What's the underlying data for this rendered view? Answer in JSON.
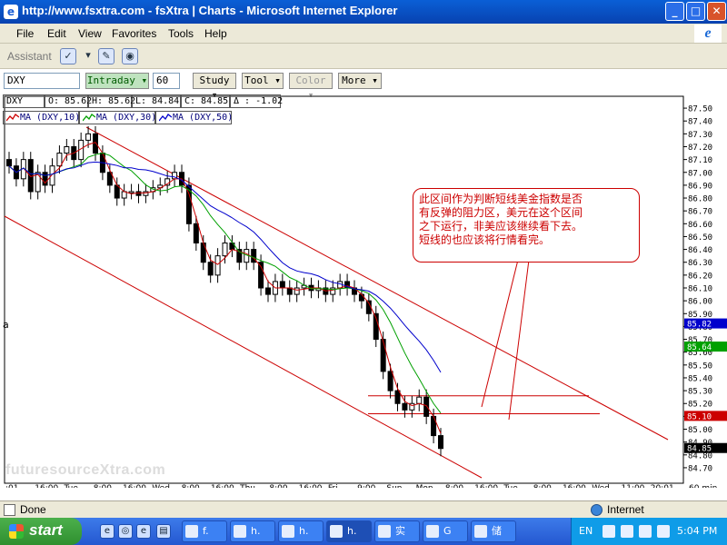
{
  "window": {
    "title": "http://www.fsxtra.com - fsXtra | Charts - Microsoft Internet Explorer",
    "icon": "ie-page-icon",
    "buttons": [
      "minimize",
      "maximize",
      "close"
    ]
  },
  "menu": {
    "items": [
      "File",
      "Edit",
      "View",
      "Favorites",
      "Tools",
      "Help"
    ]
  },
  "assistant": {
    "label": "Assistant"
  },
  "toolbar": {
    "symbol": "DXY",
    "interval_label": "Intraday",
    "interval_value": "60",
    "study_label": "Study",
    "tool_label": "Tool",
    "color_label": "Color",
    "more_label": "More"
  },
  "quote": {
    "symbol": "DXY",
    "open": "O: 85.62",
    "high": "H: 85.62",
    "low": "L: 84.84",
    "close": "C: 84.85",
    "change": "Δ : -1.02"
  },
  "indicators": [
    {
      "label": "MA (DXY,10)",
      "color": "#cc0000"
    },
    {
      "label": "MA (DXY,30)",
      "color": "#00a000"
    },
    {
      "label": "MA (DXY,50)",
      "color": "#0000cc"
    }
  ],
  "left_marker": "a",
  "watermark": "futuresourceXtra.com",
  "annotation": {
    "text_lines": [
      "此区间作为判断短线美金指数是否",
      "有反弹的阻力区，美元在这个区间",
      "之下运行，非美应该继续看下去。",
      "短线的也应该将行情看完。"
    ]
  },
  "chart_data": {
    "type": "candlestick",
    "title": "",
    "y_axis": {
      "ylim": [
        84.65,
        87.55
      ],
      "ticks": [
        "87.50",
        "87.40",
        "87.30",
        "87.20",
        "87.10",
        "87.00",
        "86.90",
        "86.80",
        "86.70",
        "86.60",
        "86.50",
        "86.40",
        "86.30",
        "86.20",
        "86.10",
        "86.00",
        "85.90",
        "85.80",
        "85.70",
        "85.60",
        "85.50",
        "85.40",
        "85.30",
        "85.20",
        "85.10",
        "85.00",
        "84.90",
        "84.80",
        "84.70"
      ],
      "tick_values": [
        87.5,
        87.4,
        87.3,
        87.2,
        87.1,
        87.0,
        86.9,
        86.8,
        86.7,
        86.6,
        86.5,
        86.4,
        86.3,
        86.2,
        86.1,
        86.0,
        85.9,
        85.8,
        85.7,
        85.6,
        85.5,
        85.4,
        85.3,
        85.2,
        85.1,
        85.0,
        84.9,
        84.8,
        84.7
      ],
      "badges": [
        {
          "label": "85.82",
          "value": 85.82,
          "color": "#0000cc"
        },
        {
          "label": "85.64",
          "value": 85.64,
          "color": "#00a000"
        },
        {
          "label": "85.10",
          "value": 85.1,
          "color": "#cc0000"
        },
        {
          "label": "84.85",
          "value": 84.85,
          "color": "#000000"
        }
      ]
    },
    "x_axis": {
      "labels": [
        ":01",
        "16:00",
        "Tue",
        "8:00",
        "16:00",
        "Wed",
        "8:00",
        "16:00",
        "Thu",
        "8:00",
        "16:00",
        "Fri",
        "9:00",
        "Sun",
        "Mon",
        "8:00",
        "16:00",
        "Tue",
        "8:00",
        "16:00",
        "Wed",
        "11:00",
        "20:01"
      ],
      "unit_label": "60 min."
    },
    "series": [
      {
        "name": "DXY",
        "type": "candlestick",
        "close": [
          87.05,
          86.95,
          87.1,
          86.85,
          87.0,
          86.9,
          87.05,
          87.15,
          87.2,
          87.1,
          87.25,
          87.3,
          87.15,
          87.0,
          86.9,
          86.8,
          86.85,
          86.85,
          86.82,
          86.85,
          86.88,
          86.9,
          86.95,
          87.0,
          86.9,
          86.6,
          86.45,
          86.3,
          86.2,
          86.35,
          86.45,
          86.4,
          86.3,
          86.4,
          86.3,
          86.1,
          86.05,
          86.15,
          86.1,
          86.05,
          86.1,
          86.12,
          86.08,
          86.1,
          86.05,
          86.1,
          86.15,
          86.1,
          86.05,
          86.0,
          85.9,
          85.7,
          85.45,
          85.3,
          85.2,
          85.15,
          85.2,
          85.25,
          85.1,
          84.95,
          84.85
        ]
      },
      {
        "name": "MA (DXY,10)",
        "color": "#cc0000"
      },
      {
        "name": "MA (DXY,30)",
        "color": "#00a000"
      },
      {
        "name": "MA (DXY,50)",
        "color": "#0000cc"
      }
    ],
    "annotations": {
      "resistance_zone": [
        85.12,
        85.26
      ],
      "channel": "descending"
    }
  },
  "statusbar": {
    "status": "Done",
    "zone": "Internet"
  },
  "taskbar": {
    "start_label": "start",
    "tasks": [
      {
        "label": "f."
      },
      {
        "label": "h."
      },
      {
        "label": "h."
      },
      {
        "label": "h."
      },
      {
        "label": "实"
      },
      {
        "label": "G"
      },
      {
        "label": "储"
      }
    ],
    "lang": "EN",
    "clock": "5:04 PM"
  }
}
